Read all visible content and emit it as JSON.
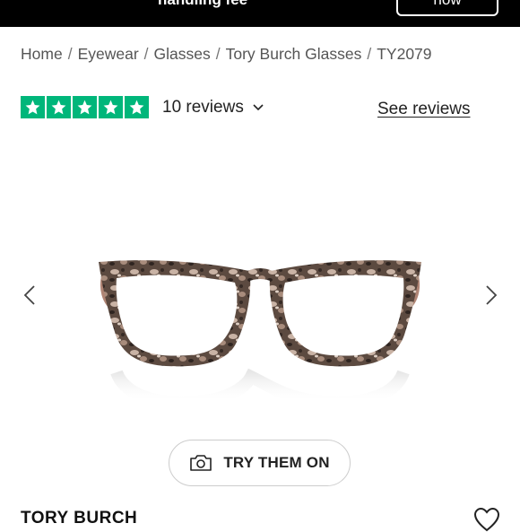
{
  "promo": {
    "text": "handling fee",
    "button_label": "now"
  },
  "breadcrumb": {
    "items": [
      "Home",
      "Eyewear",
      "Glasses",
      "Tory Burch Glasses",
      "TY2079"
    ],
    "separator": "/"
  },
  "rating": {
    "stars": 5,
    "reviews_label": "10 reviews",
    "see_reviews_label": "See reviews",
    "star_color": "#00b67a"
  },
  "gallery": {
    "prev_icon": "chevron-left-icon",
    "next_icon": "chevron-right-icon"
  },
  "try_on": {
    "label": "TRY THEM ON",
    "icon": "camera-icon"
  },
  "product": {
    "brand": "TORY BURCH",
    "wishlist_icon": "heart-icon"
  }
}
